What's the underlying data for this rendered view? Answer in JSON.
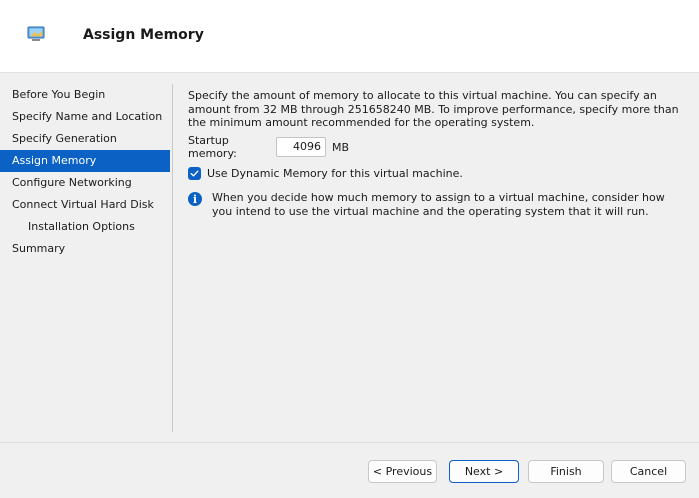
{
  "header": {
    "title": "Assign Memory",
    "icon": "virtual-machine-icon"
  },
  "steps": [
    {
      "label": "Before You Begin",
      "active": false,
      "indent": false
    },
    {
      "label": "Specify Name and Location",
      "active": false,
      "indent": false
    },
    {
      "label": "Specify Generation",
      "active": false,
      "indent": false
    },
    {
      "label": "Assign Memory",
      "active": true,
      "indent": false
    },
    {
      "label": "Configure Networking",
      "active": false,
      "indent": false
    },
    {
      "label": "Connect Virtual Hard Disk",
      "active": false,
      "indent": false
    },
    {
      "label": "Installation Options",
      "active": false,
      "indent": true
    },
    {
      "label": "Summary",
      "active": false,
      "indent": false
    }
  ],
  "content": {
    "description": "Specify the amount of memory to allocate to this virtual machine. You can specify an amount from 32 MB through 251658240 MB. To improve performance, specify more than the minimum amount recommended for the operating system.",
    "startup_label": "Startup memory:",
    "startup_value": "4096",
    "startup_unit": "MB",
    "dynamic_label": "Use Dynamic Memory for this virtual machine.",
    "dynamic_checked": true,
    "info_text": "When you decide how much memory to assign to a virtual machine, consider how you intend to use the virtual machine and the operating system that it will run."
  },
  "buttons": {
    "previous": "< Previous",
    "next": "Next >",
    "finish": "Finish",
    "cancel": "Cancel"
  },
  "colors": {
    "accent": "#0b62c4"
  }
}
